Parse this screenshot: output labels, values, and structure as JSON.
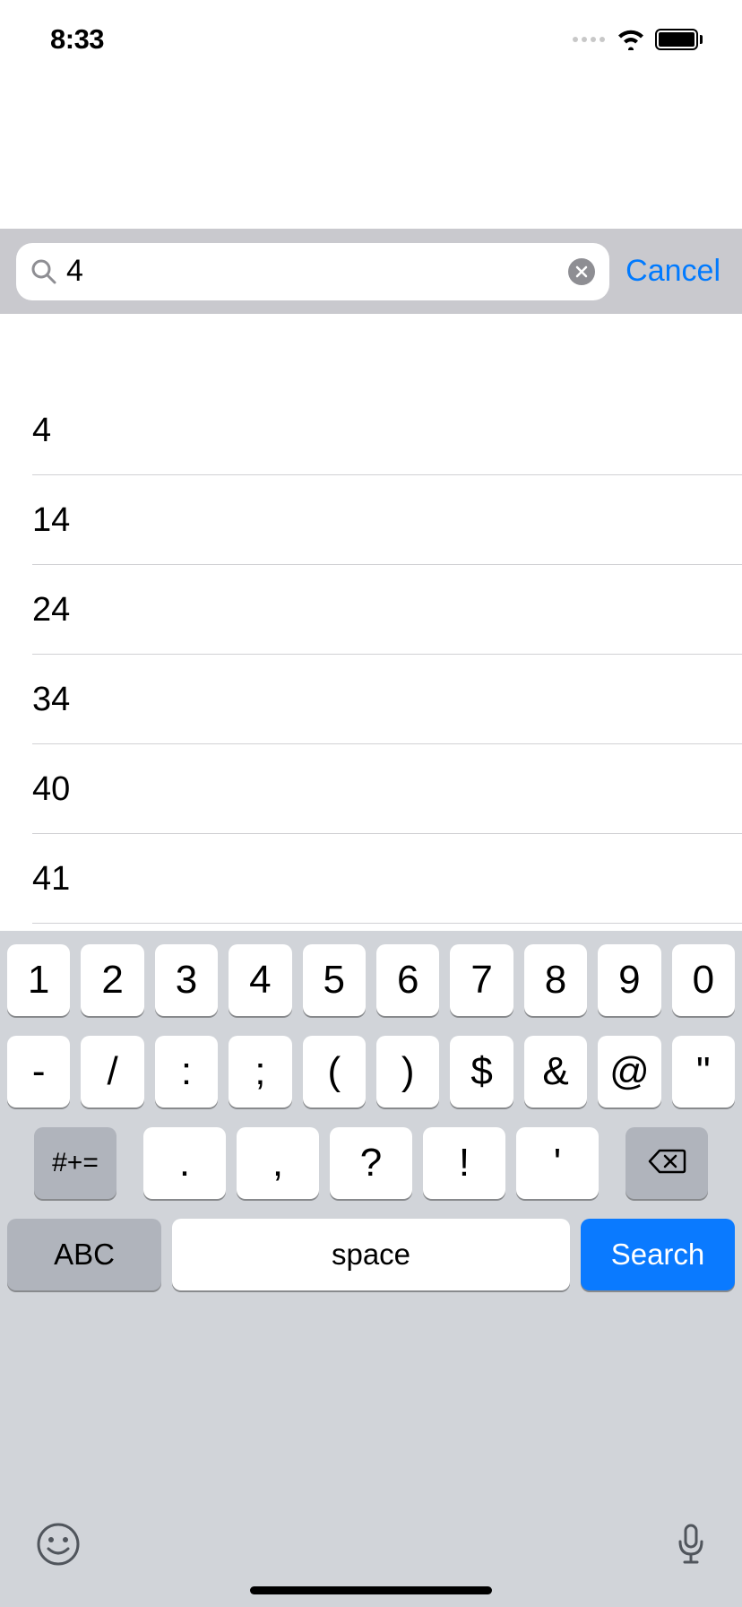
{
  "status": {
    "time": "8:33"
  },
  "search": {
    "value": "4",
    "cancel_label": "Cancel"
  },
  "results": [
    "4",
    "14",
    "24",
    "34",
    "40",
    "41"
  ],
  "keyboard": {
    "row1": [
      "1",
      "2",
      "3",
      "4",
      "5",
      "6",
      "7",
      "8",
      "9",
      "0"
    ],
    "row2": [
      "-",
      "/",
      ":",
      ";",
      "(",
      ")",
      "$",
      "&",
      "@",
      "\""
    ],
    "row3_sym": "#+=",
    "row3": [
      ".",
      ",",
      "?",
      "!",
      "'"
    ],
    "row4_abc": "ABC",
    "row4_space": "space",
    "row4_search": "Search"
  }
}
